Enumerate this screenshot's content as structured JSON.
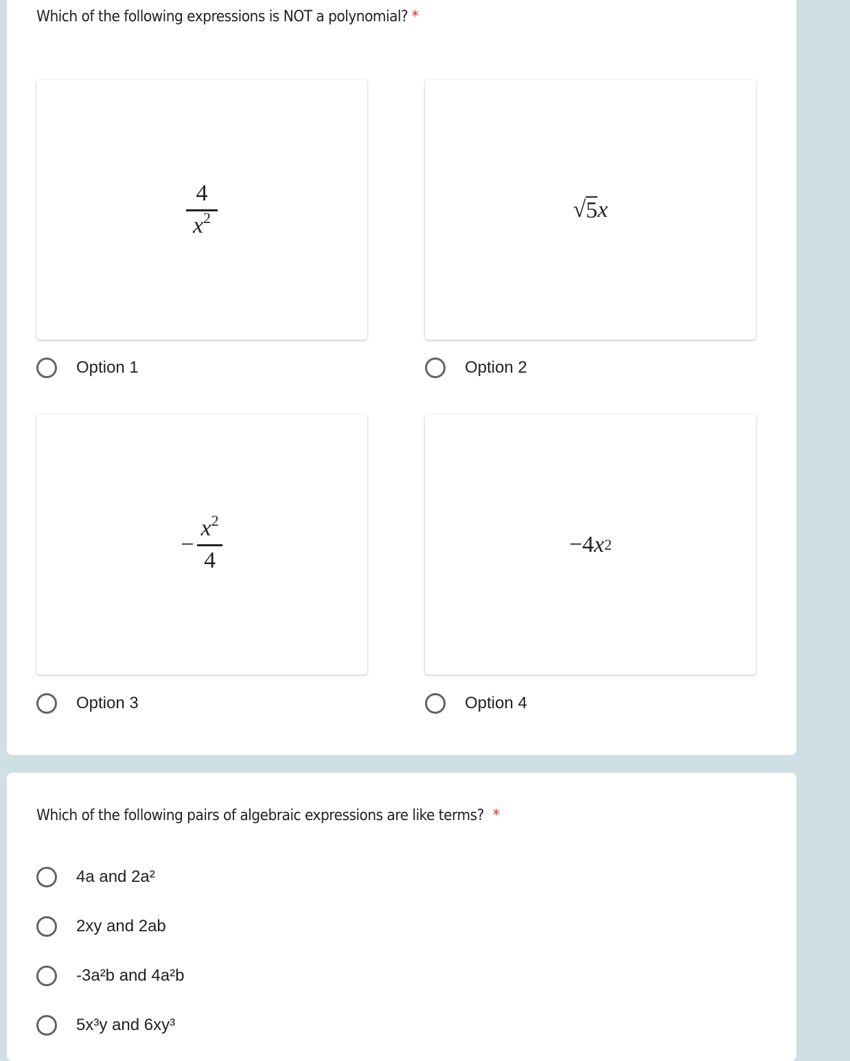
{
  "colors": {
    "background": "#cfe0e4",
    "card": "#ffffff",
    "required": "#d93025",
    "radio": "#5f6368"
  },
  "question1": {
    "title": "Which of the following expressions is NOT a polynomial?",
    "required_marker": "*",
    "options": [
      {
        "label": "Option 1",
        "expression": {
          "numerator": "4",
          "denominator_base": "x",
          "denominator_exp": "2"
        }
      },
      {
        "label": "Option 2",
        "expression": {
          "radical": "√",
          "radicand": "5",
          "var": "x"
        }
      },
      {
        "label": "Option 3",
        "expression": {
          "sign": "−",
          "numerator_base": "x",
          "numerator_exp": "2",
          "denominator": "4"
        }
      },
      {
        "label": "Option 4",
        "expression": {
          "coef": "−4",
          "var": "x",
          "exp": "2"
        }
      }
    ]
  },
  "question2": {
    "title": "Which of the following pairs of algebraic expressions are like terms?",
    "required_marker": "*",
    "options": [
      {
        "label": "4a and 2a²"
      },
      {
        "label": "2xy and 2ab"
      },
      {
        "label": "-3a²b and 4a²b"
      },
      {
        "label": "5x³y and 6xy³"
      }
    ]
  }
}
